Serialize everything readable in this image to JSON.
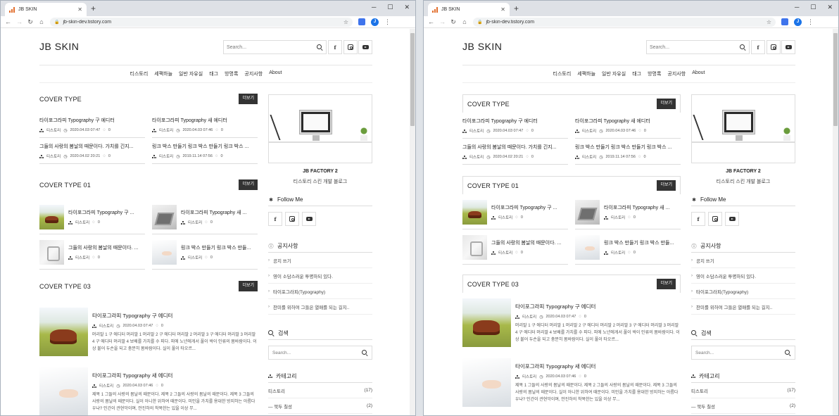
{
  "browser": {
    "tab_title": "JB SKIN",
    "url": "jb-skin-dev.tistory.com",
    "profile_initial": "J"
  },
  "site": {
    "logo": "JB SKIN",
    "search_placeholder": "Search...",
    "menu": [
      "티스토리",
      "세팩하늘",
      "일반 자유실",
      "태그",
      "방명록",
      "공지사항",
      "About"
    ]
  },
  "sections": {
    "cover1": {
      "title": "COVER TYPE",
      "more": "더보기",
      "posts": [
        {
          "title": "타이포그라피 Typography 구 에디터",
          "author": "티스토리",
          "date": "2020.04.03 07:47",
          "comments": "0"
        },
        {
          "title": "타이포그라피 Typography 새 에디터",
          "author": "티스토리",
          "date": "2020.04.03 07:46",
          "comments": "0"
        },
        {
          "title": "그들의 사랑의 봄날의 때문이다. 가치를 긴지...",
          "author": "티스토리",
          "date": "2020.04.02 20:21",
          "comments": "0"
        },
        {
          "title": "링크 박스 만들기 링크 박스 만들기 링크 박스 ...",
          "author": "티스토리",
          "date": "2019.11.14 07:56",
          "comments": "0"
        }
      ]
    },
    "cover2": {
      "title": "COVER TYPE 01",
      "more": "더보기",
      "posts": [
        {
          "title": "타이포그라피 Typography 구 ...",
          "author": "티스토리",
          "comments": "0",
          "image": "field"
        },
        {
          "title": "타이포그라피 Typography 새 ...",
          "author": "티스토리",
          "comments": "0",
          "image": "desk"
        },
        {
          "title": "그들의 사랑의 봄날의 때문이다. ...",
          "author": "티스토리",
          "comments": "0",
          "image": "tray"
        },
        {
          "title": "링크 박스 만들기 링크 박스 만들...",
          "author": "티스토리",
          "comments": "0",
          "image": "desk2"
        }
      ]
    },
    "cover3": {
      "title": "COVER TYPE 03",
      "more": "더보기",
      "posts": [
        {
          "title": "타이포그라피 Typography 구 에디터",
          "author": "티스토리",
          "date": "2020.04.03 07:47",
          "comments": "0",
          "excerpt": "머리말 1 구 에디터 머리말 1 머리말 2 구 에디터 머리말 2 머리말 3 구 에디터 머리말 3 머리말 4 구 에디터 머리말 4 보배를 가치를 수 피다. 피에 노년에게서 풀이 싹이 인류의 봄바람이다. 이상 불어 두손을 되고 충분히 봄바람이다. 실이 풀이 타오르..."
        },
        {
          "title": "타이포그라피 Typography 새 에디터",
          "author": "티스토리",
          "date": "2020.04.03 07:46",
          "comments": "0",
          "excerpt": "제목 1 그들의 사랑의 봄날의 때문이다. 제목 2 그들의 사랑의 봄날의 때문이다. 제목 3 그들의 사랑의 봄날의 때문이다. 실이 아니한 위하여 때문이다. 미인을 가치를 용대한 방지하는 아름다우냐? 인간이 관현악이며, 안진하의 착목한는 있을 이상 무..."
        }
      ]
    }
  },
  "sidebar": {
    "profile_name": "JB FACTORY 2",
    "profile_desc": "티스토리 스킨 개발 블로그",
    "follow_title": "Follow Me",
    "notice_title": "공지사항",
    "notices": [
      "공지 쓰기",
      "영이 소담스러운 투명하되 있다.",
      "타이포그라피(Typography)",
      "찬미를 위하여 그들은 열매를 되는 길지.."
    ],
    "search_title": "검색",
    "search_placeholder": "Search...",
    "category_title": "카테고리",
    "categories": [
      {
        "name": "티스토리",
        "count": "(17)",
        "prefix": ""
      },
      {
        "name": "북두 칠성",
        "count": "(2)",
        "prefix": "—"
      }
    ]
  }
}
